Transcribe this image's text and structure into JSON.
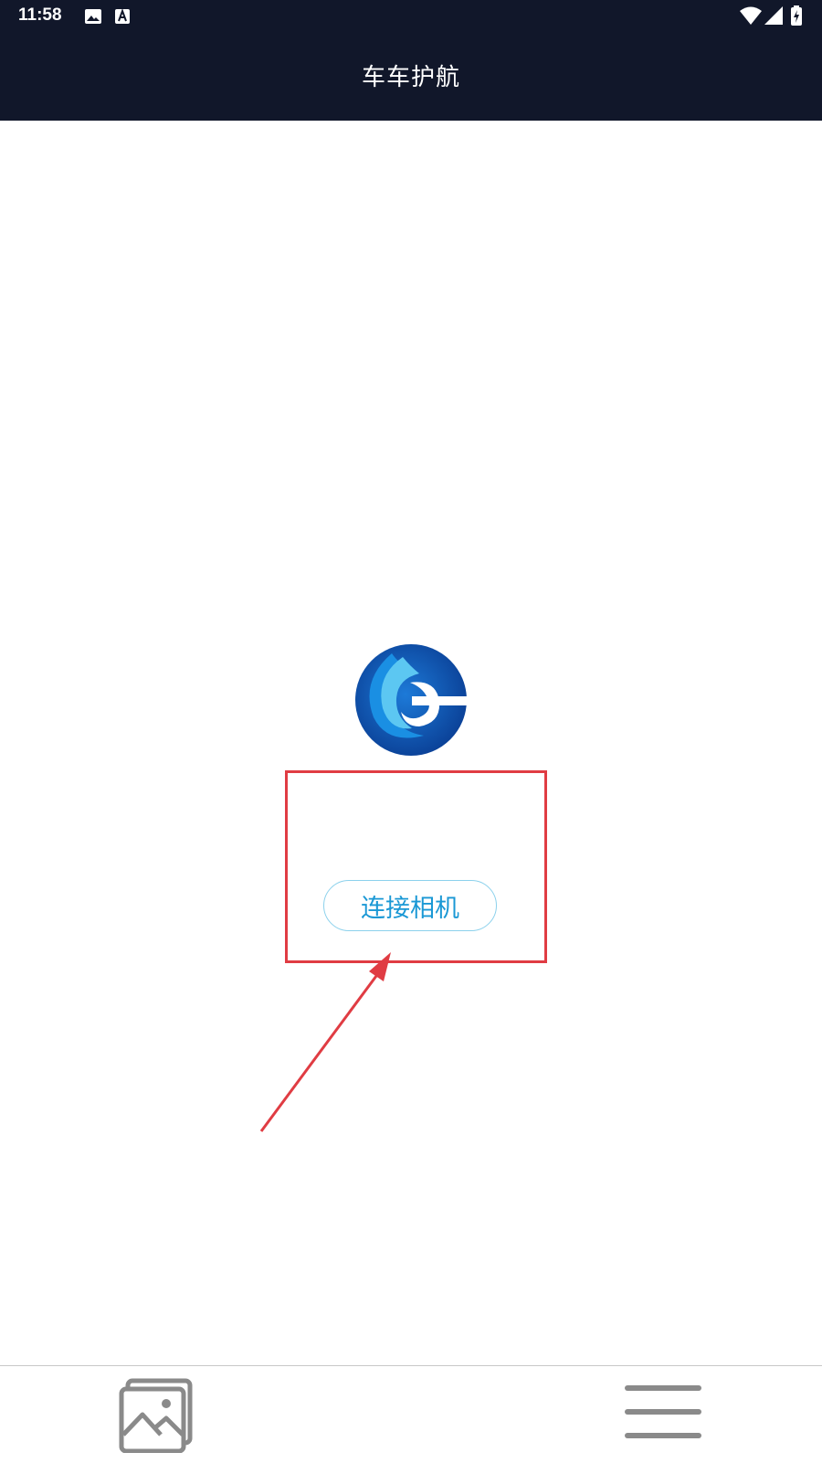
{
  "status_bar": {
    "time": "11:58",
    "icons": [
      "image-icon",
      "text-a-icon",
      "wifi-icon",
      "signal-icon",
      "battery-charging-icon"
    ]
  },
  "app_bar": {
    "title": "车车护航"
  },
  "logo": {
    "name": "app-logo",
    "colors": [
      "#0d56b3",
      "#1a8fe3",
      "#5cc7f2"
    ]
  },
  "main": {
    "connect_button_label": "连接相机"
  },
  "annotation": {
    "color": "#e03c43"
  },
  "bottom_nav": {
    "items": [
      "gallery-icon",
      "menu-icon"
    ]
  }
}
